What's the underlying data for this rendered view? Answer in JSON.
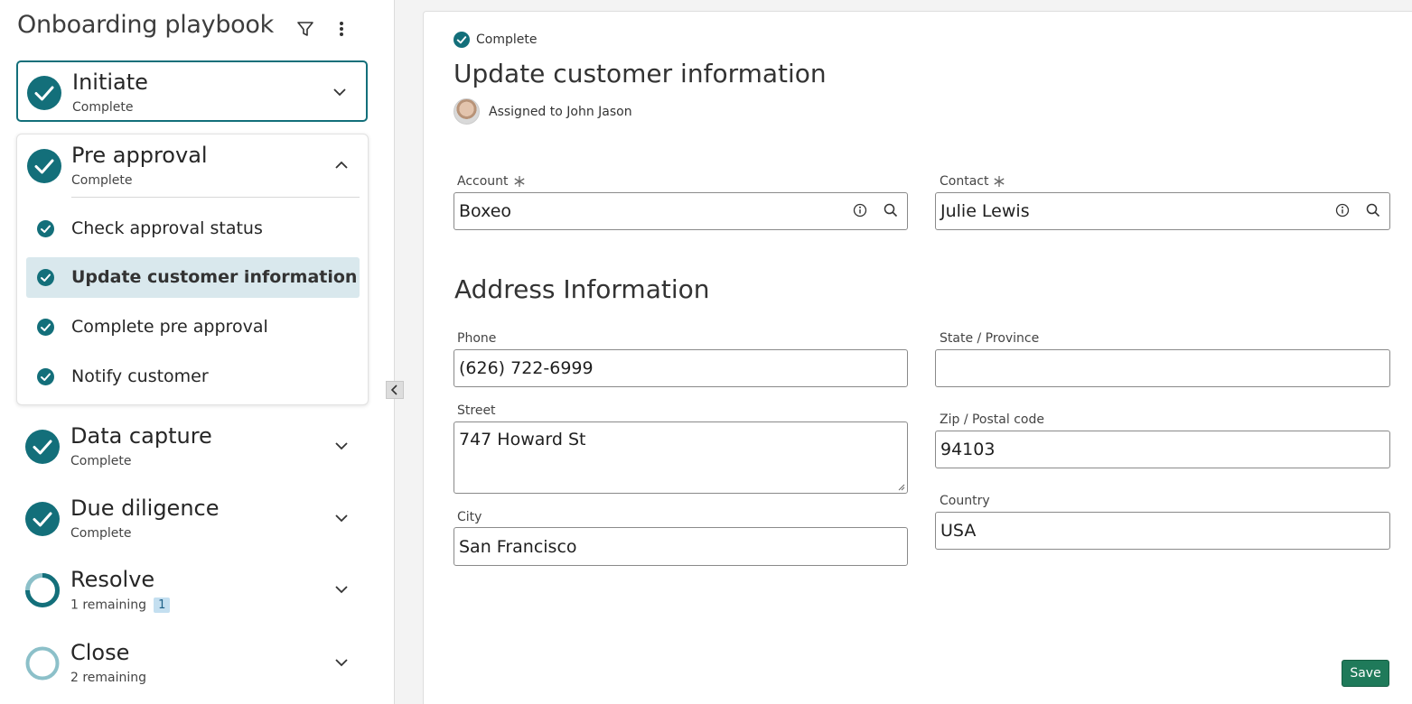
{
  "sidebar": {
    "title": "Onboarding playbook",
    "stages": [
      {
        "name": "Initiate",
        "status": "Complete"
      },
      {
        "name": "Pre approval",
        "status": "Complete",
        "steps": [
          {
            "label": "Check approval status"
          },
          {
            "label": "Update customer information"
          },
          {
            "label": "Complete pre approval"
          },
          {
            "label": "Notify customer"
          }
        ]
      },
      {
        "name": "Data capture",
        "status": "Complete"
      },
      {
        "name": "Due diligence",
        "status": "Complete"
      },
      {
        "name": "Resolve",
        "status": "1 remaining",
        "badge": "1"
      },
      {
        "name": "Close",
        "status": "2 remaining"
      }
    ]
  },
  "main": {
    "status": "Complete",
    "title": "Update customer information",
    "assignee": "Assigned to John Jason",
    "section_title": "Address Information",
    "fields": {
      "account": {
        "label": "Account",
        "value": "Boxeo"
      },
      "contact": {
        "label": "Contact",
        "value": "Julie Lewis"
      },
      "phone": {
        "label": "Phone",
        "value": "(626) 722-6999"
      },
      "state": {
        "label": "State / Province",
        "value": ""
      },
      "street": {
        "label": "Street",
        "value": "747 Howard St"
      },
      "zip": {
        "label": "Zip / Postal code",
        "value": "94103"
      },
      "city": {
        "label": "City",
        "value": "San Francisco"
      },
      "country": {
        "label": "Country",
        "value": "USA"
      }
    },
    "save_label": "Save"
  },
  "colors": {
    "accent": "#136f7a",
    "selected_step_bg": "#d9e8ed",
    "save_button": "#1f7a5a",
    "badge_bg": "#c4dff0"
  },
  "icons": {
    "filter": "filter-icon",
    "more": "more-vertical-icon",
    "complete": "check-circle-icon",
    "info": "info-icon",
    "search": "search-icon",
    "expand": "chevron-down-icon",
    "collapse": "chevron-up-icon",
    "collapse_panel": "chevron-left-icon"
  }
}
